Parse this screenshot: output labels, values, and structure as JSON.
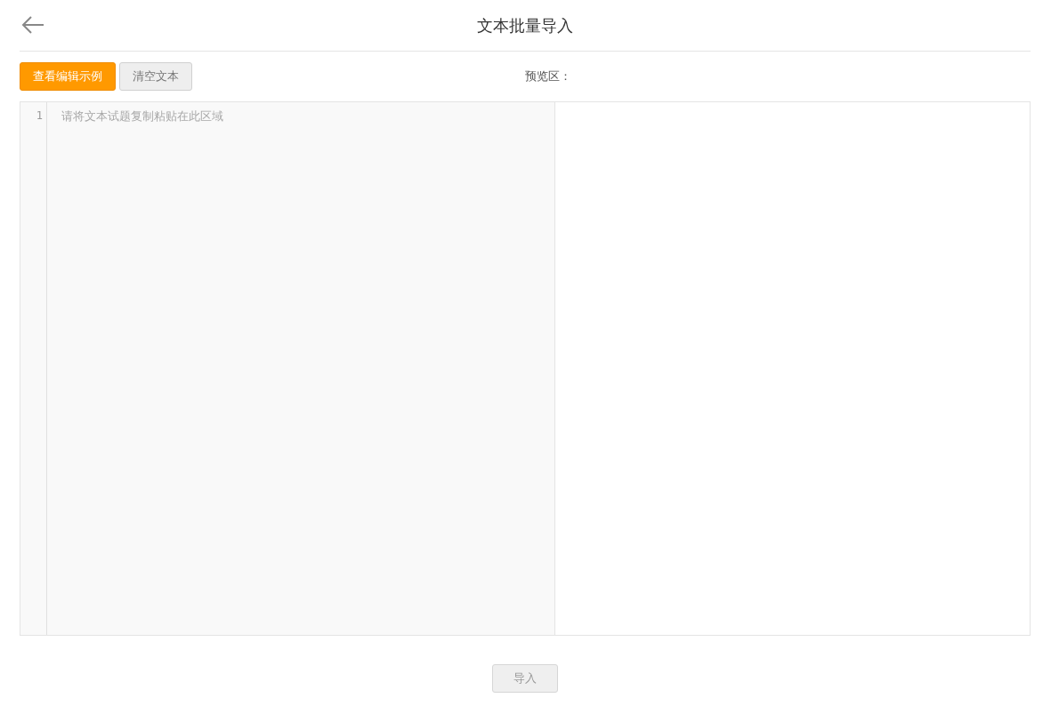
{
  "header": {
    "title": "文本批量导入"
  },
  "toolbar": {
    "buttons": [
      {
        "label": "查看编辑示例",
        "kind": "primary"
      },
      {
        "label": "清空文本",
        "kind": "default"
      }
    ],
    "preview_label": "预览区："
  },
  "editor": {
    "line_numbers": [
      "1"
    ],
    "placeholder": "请将文本试题复制粘贴在此区域"
  },
  "import_button": {
    "label": "导入",
    "disabled": true
  }
}
